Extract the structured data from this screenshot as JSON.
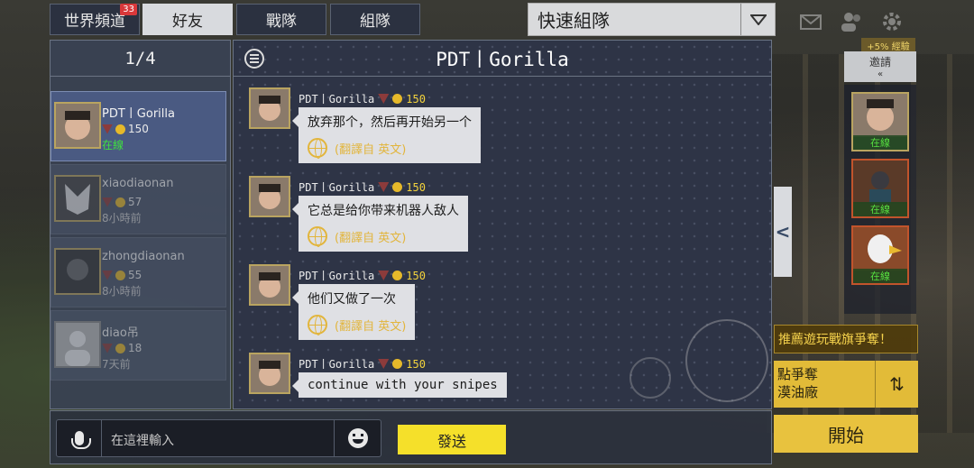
{
  "tabs": [
    {
      "label": "世界頻道",
      "badge": "33"
    },
    {
      "label": "好友"
    },
    {
      "label": "戰隊"
    },
    {
      "label": "組隊"
    }
  ],
  "dropdown": {
    "label": "快速組隊"
  },
  "friends_panel": {
    "page": "1/4",
    "friends": [
      {
        "name": "PDT丨Gorilla",
        "level": "150",
        "status": "在線"
      },
      {
        "name": "xiaodiaonan",
        "level": "57",
        "status": "8小時前"
      },
      {
        "name": "zhongdiaonan",
        "level": "55",
        "status": "8小時前"
      },
      {
        "name": "diao吊",
        "level": "18",
        "status": "7天前"
      }
    ]
  },
  "chat": {
    "title": "PDT丨Gorilla",
    "messages": [
      {
        "name": "PDT丨Gorilla",
        "level": "150",
        "text": "放弃那个，然后再开始另一个",
        "translation": "(翻譯自 英文)"
      },
      {
        "name": "PDT丨Gorilla",
        "level": "150",
        "text": "它总是给你带来机器人敌人",
        "translation": "(翻譯自 英文)"
      },
      {
        "name": "PDT丨Gorilla",
        "level": "150",
        "text": "他们又做了一次",
        "translation": "(翻譯自 英文)"
      },
      {
        "name": "PDT丨Gorilla",
        "level": "150",
        "text": "continue with your snipes",
        "translation": ""
      }
    ]
  },
  "input": {
    "placeholder": "在這裡輸入",
    "send_label": "發送"
  },
  "right": {
    "exp": "+5% 經驗",
    "invite": "邀請",
    "slots": [
      {
        "status": "在線"
      },
      {
        "status": "在線"
      },
      {
        "status": "在線"
      }
    ],
    "banner": "推薦遊玩戰旗爭奪！",
    "mode_line1": "點爭奪",
    "mode_line2": "漠油廠",
    "start_label": "開始"
  }
}
